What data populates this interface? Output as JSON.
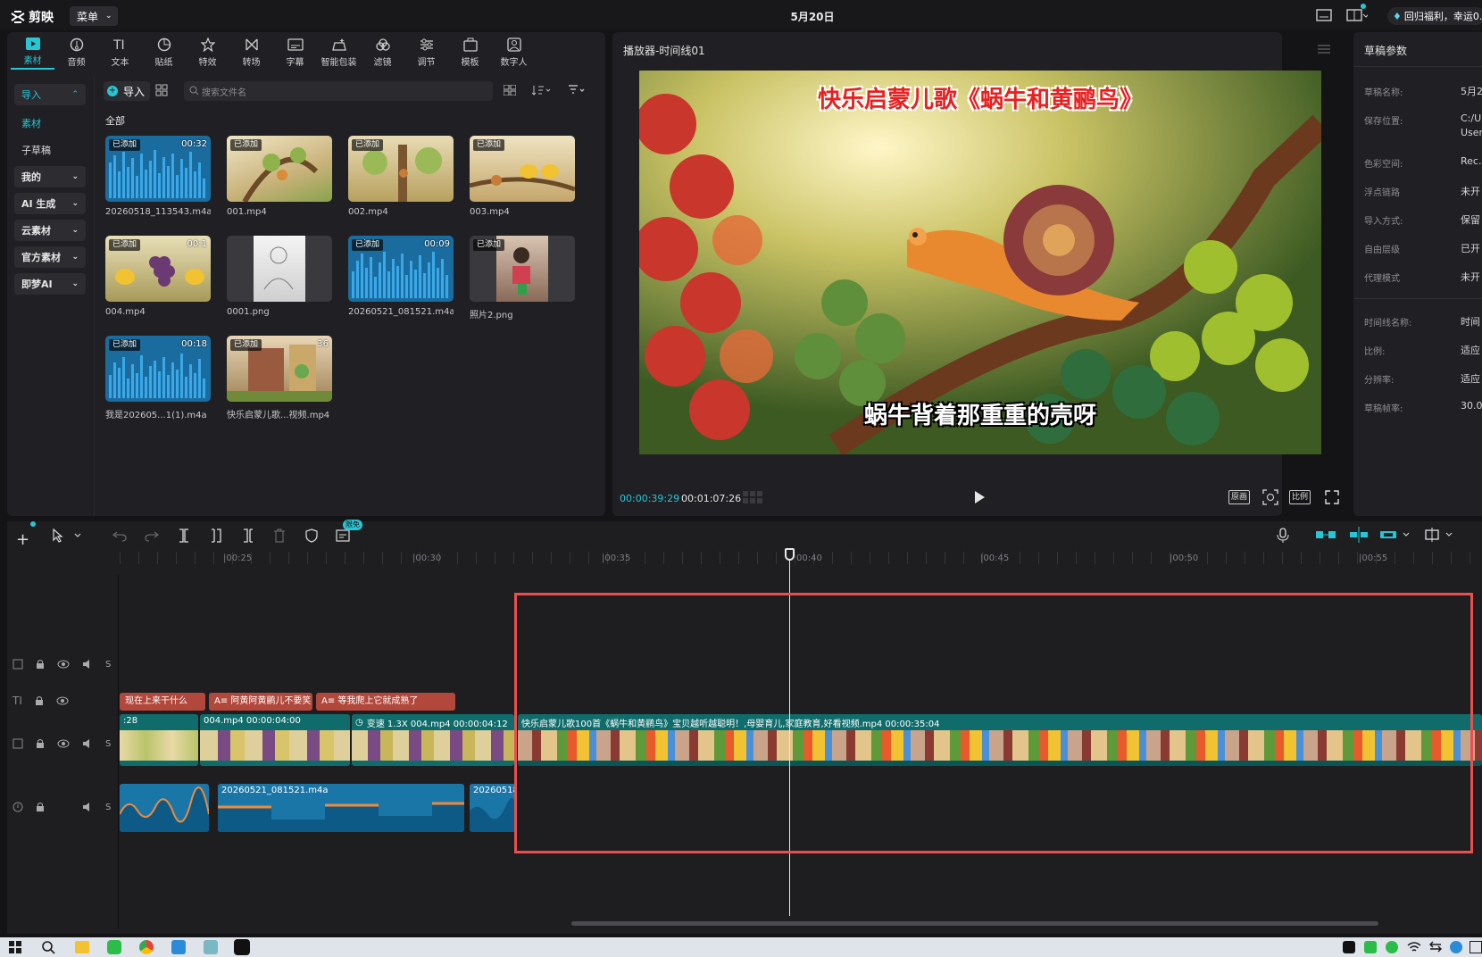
{
  "app": {
    "logo": "剪映",
    "menu": "菜单",
    "title": "5月20日",
    "promo": "回归福利，幸运0.."
  },
  "toolbar": {
    "tabs": [
      {
        "label": "素材",
        "icon": "media-icon"
      },
      {
        "label": "音频",
        "icon": "audio-icon"
      },
      {
        "label": "文本",
        "icon": "text-icon"
      },
      {
        "label": "贴纸",
        "icon": "sticker-icon"
      },
      {
        "label": "特效",
        "icon": "effects-icon"
      },
      {
        "label": "转场",
        "icon": "transition-icon"
      },
      {
        "label": "字幕",
        "icon": "subtitle-icon"
      },
      {
        "label": "智能包装",
        "icon": "smart-pack-icon"
      },
      {
        "label": "滤镜",
        "icon": "filter-icon"
      },
      {
        "label": "调节",
        "icon": "adjust-icon"
      },
      {
        "label": "模板",
        "icon": "template-icon"
      },
      {
        "label": "数字人",
        "icon": "avatar-icon"
      }
    ]
  },
  "sidebar": {
    "import": "导入",
    "material": "素材",
    "draft": "子草稿",
    "mine": "我的",
    "ai_gen": "AI 生成",
    "cloud": "云素材",
    "official": "官方素材",
    "jimeng": "即梦AI"
  },
  "media": {
    "import_label": "导入",
    "search_placeholder": "搜索文件名",
    "section": "全部",
    "added_badge": "已添加",
    "items": [
      {
        "name": "20260518_113543.m4a",
        "duration": "00:32",
        "type": "audio"
      },
      {
        "name": "001.mp4",
        "duration": "",
        "type": "video"
      },
      {
        "name": "002.mp4",
        "duration": "",
        "type": "video"
      },
      {
        "name": "003.mp4",
        "duration": "",
        "type": "video"
      },
      {
        "name": "004.mp4",
        "duration": "00:1",
        "type": "video"
      },
      {
        "name": "0001.png",
        "duration": "",
        "type": "image"
      },
      {
        "name": "20260521_081521.m4a",
        "duration": "00:09",
        "type": "audio"
      },
      {
        "name": "照片2.png",
        "duration": "",
        "type": "image"
      },
      {
        "name": "我是202605...1(1).m4a",
        "duration": "00:18",
        "type": "audio"
      },
      {
        "name": "快乐启蒙儿歌...视频.mp4",
        "duration": "36",
        "type": "video"
      }
    ]
  },
  "player": {
    "title": "播放器-时间线01",
    "video_title": "快乐启蒙儿歌《蜗牛和黄鹂鸟》",
    "video_subtitle": "蜗牛背着那重重的壳呀",
    "current": "00:00:39:29",
    "total": "00:01:07:26",
    "btn_original": "原画",
    "btn_ratio": "比例"
  },
  "props": {
    "title": "草稿参数",
    "rows": [
      {
        "label": "草稿名称:",
        "value": "5月2"
      },
      {
        "label": "保存位置:",
        "value": "C:/U"
      },
      {
        "label": "",
        "value": "User"
      },
      {
        "label": "色彩空间:",
        "value": "Rec."
      },
      {
        "label": "浮点链路",
        "value": "未开"
      },
      {
        "label": "导入方式:",
        "value": "保留"
      },
      {
        "label": "自由层级",
        "value": "已开"
      },
      {
        "label": "代理模式",
        "value": "未开"
      },
      {
        "label": "时间线名称:",
        "value": "时间"
      },
      {
        "label": "比例:",
        "value": "适应"
      },
      {
        "label": "分辨率:",
        "value": "适应"
      },
      {
        "label": "草稿帧率:",
        "value": "30.0"
      }
    ]
  },
  "timeline": {
    "new_badge": "限免",
    "ruler": [
      "|00:25",
      "|00:30",
      "|00:35",
      "00:40",
      "|00:45",
      "|00:50",
      "|00:55"
    ],
    "text_clips": [
      "现在上来干什么",
      "A≡ 阿黄阿黄鹂儿不要笑",
      "A≡ 等我爬上它就成熟了"
    ],
    "video_clips": [
      {
        "label": ":28"
      },
      {
        "label": "004.mp4   00:00:04:00"
      },
      {
        "label": "变速 1.3X  004.mp4   00:00:04:12"
      },
      {
        "label": "快乐启蒙儿歌100首《蜗牛和黄鹂鸟》宝贝越听越聪明！,母婴育儿,家庭教育,好看视频.mp4   00:00:35:04"
      }
    ],
    "audio_clips": [
      {
        "label": ""
      },
      {
        "label": "20260521_081521.m4a"
      },
      {
        "label": "20260518"
      }
    ],
    "track_s": "S"
  }
}
